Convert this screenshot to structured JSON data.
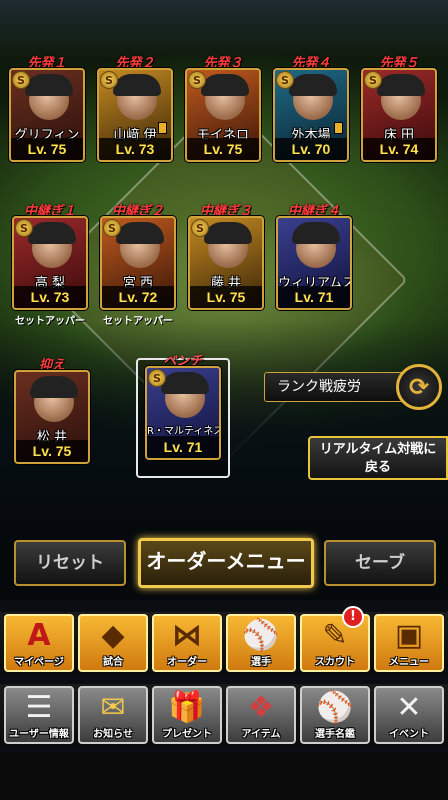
{
  "lineup": {
    "starters": [
      {
        "tag": "先発１",
        "name": "グリフィン",
        "level": "Lv. 75",
        "theme": "card"
      },
      {
        "tag": "先発２",
        "name": "山﨑 伊",
        "level": "Lv. 73",
        "theme": "card gold"
      },
      {
        "tag": "先発３",
        "name": "モイネロ",
        "level": "Lv. 75",
        "theme": "card orange"
      },
      {
        "tag": "先発４",
        "name": "外木場",
        "level": "Lv. 70",
        "theme": "card teal"
      },
      {
        "tag": "先発５",
        "name": "床 田",
        "level": "Lv. 74",
        "theme": "card red"
      }
    ],
    "relievers": [
      {
        "tag": "中継ぎ１",
        "name": "高 梨",
        "level": "Lv. 73",
        "sub": "セットアッパー",
        "theme": "card red"
      },
      {
        "tag": "中継ぎ２",
        "name": "宮 西",
        "level": "Lv. 72",
        "sub": "セットアッパー",
        "theme": "card orange"
      },
      {
        "tag": "中継ぎ３",
        "name": "藤 井",
        "level": "Lv. 75",
        "sub": "",
        "theme": "card gold"
      },
      {
        "tag": "中継ぎ４",
        "name": "ウィリアムス",
        "level": "Lv. 71",
        "sub": "",
        "theme": "card blue"
      }
    ],
    "closer": {
      "tag": "抑え",
      "name": "松 井",
      "level": "Lv. 75",
      "theme": "card"
    },
    "bench": {
      "tag": "ベンチ",
      "name": "R・マルティネス",
      "level": "Lv. 71",
      "theme": "card blue"
    }
  },
  "badge_s": "S",
  "rank": {
    "label": "ランク戦疲労",
    "icon": "refresh-arrows-icon"
  },
  "realtime": {
    "line1": "リアルタイム対戦に",
    "line2": "戻る"
  },
  "controls": {
    "reset": "リセット",
    "order_menu": "オーダーメニュー",
    "save": "セーブ"
  },
  "menu_row1": [
    {
      "label": "マイページ",
      "icon": "A"
    },
    {
      "label": "試合",
      "icon": "◆"
    },
    {
      "label": "オーダー",
      "icon": "⋈"
    },
    {
      "label": "選手",
      "icon": "⚾"
    },
    {
      "label": "スカウト",
      "icon": "✎"
    },
    {
      "label": "メニュー",
      "icon": "▣"
    }
  ],
  "notice_count": "!",
  "menu_row2": [
    {
      "label": "ユーザー情報",
      "icon": "☰"
    },
    {
      "label": "お知らせ",
      "icon": "✉"
    },
    {
      "label": "プレゼント",
      "icon": "🎁"
    },
    {
      "label": "アイテム",
      "icon": "❖"
    },
    {
      "label": "選手名鑑",
      "icon": "⚾"
    },
    {
      "label": "イベント",
      "icon": "✕"
    }
  ]
}
